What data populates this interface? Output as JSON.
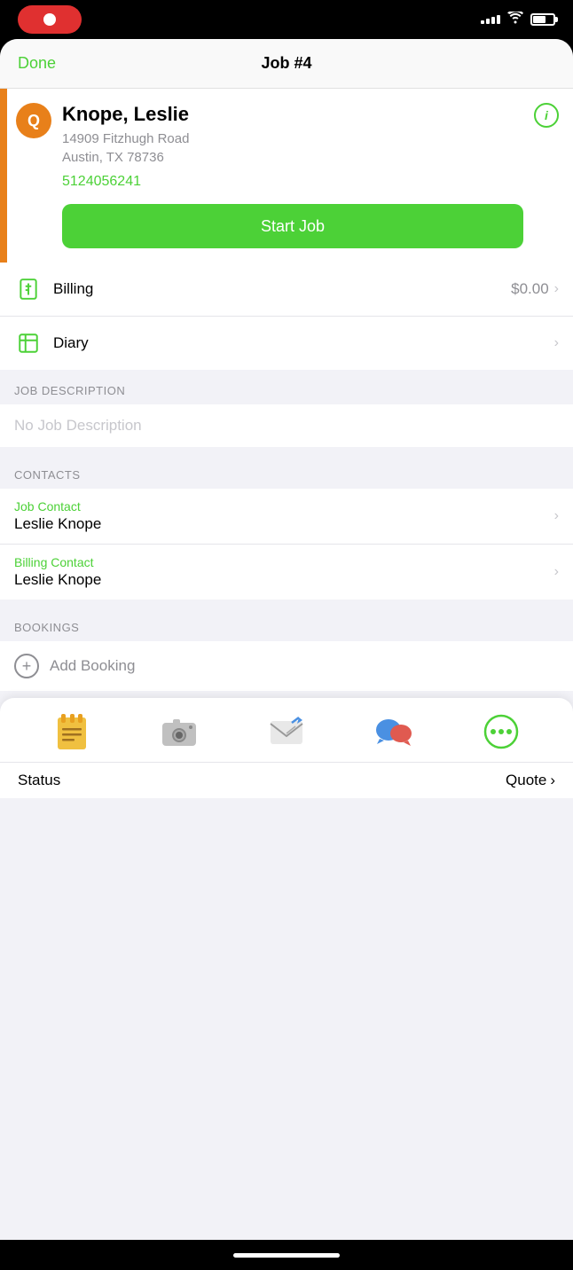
{
  "statusBar": {
    "signalBars": [
      4,
      6,
      8,
      10,
      12
    ],
    "batteryPercent": 65
  },
  "nav": {
    "done": "Done",
    "title": "Job #4"
  },
  "customer": {
    "initial": "Q",
    "name": "Knope, Leslie",
    "address1": "14909 Fitzhugh Road",
    "address2": "Austin, TX 78736",
    "phone": "5124056241",
    "startJobLabel": "Start Job"
  },
  "menuItems": [
    {
      "label": "Billing",
      "value": "$0.00",
      "icon": "billing"
    },
    {
      "label": "Diary",
      "value": "",
      "icon": "diary"
    }
  ],
  "sections": {
    "jobDescription": {
      "header": "JOB DESCRIPTION",
      "placeholder": "No Job Description"
    },
    "contacts": {
      "header": "CONTACTS",
      "items": [
        {
          "label": "Job Contact",
          "name": "Leslie Knope"
        },
        {
          "label": "Billing Contact",
          "name": "Leslie Knope"
        }
      ]
    },
    "bookings": {
      "header": "BOOKINGS",
      "addLabel": "Add Booking"
    }
  },
  "toolbar": {
    "items": [
      {
        "icon": "📋",
        "name": "notes"
      },
      {
        "icon": "📷",
        "name": "camera"
      },
      {
        "icon": "✉️",
        "name": "email"
      },
      {
        "icon": "💬",
        "name": "chat"
      },
      {
        "icon": "more",
        "name": "more"
      }
    ]
  },
  "bottomBar": {
    "statusLabel": "Status",
    "quoteLabel": "Quote"
  },
  "colors": {
    "green": "#4cd137",
    "orange": "#e8801a",
    "gray": "#8e8e93",
    "lightGray": "#c7c7cc"
  }
}
